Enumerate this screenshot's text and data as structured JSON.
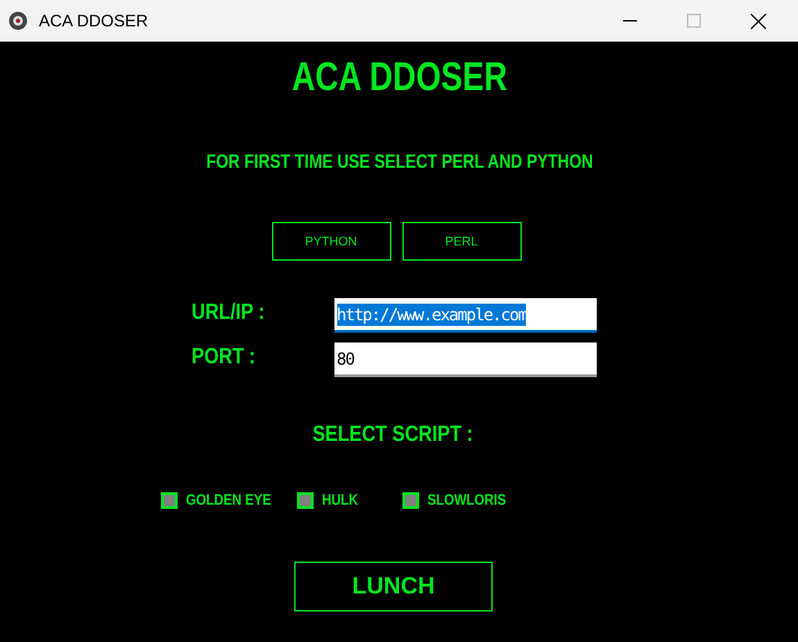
{
  "window": {
    "title": "ACA DDOSER"
  },
  "heading": "ACA DDOSER",
  "notice": "FOR FIRST TIME USE SELECT PERL AND PYTHON",
  "setup_buttons": [
    "PYTHON",
    "PERL"
  ],
  "fields": [
    {
      "label": "URL/IP :",
      "value": "http://www.example.com",
      "text_selected": true
    },
    {
      "label": "PORT :",
      "value": "80",
      "text_selected": false
    }
  ],
  "script_label": "SELECT SCRIPT :",
  "scripts": [
    {
      "label": "GOLDEN EYE",
      "checked": false
    },
    {
      "label": "HULK",
      "checked": false
    },
    {
      "label": "SLOWLORIS",
      "checked": false
    }
  ],
  "launch_button": "LUNCH"
}
